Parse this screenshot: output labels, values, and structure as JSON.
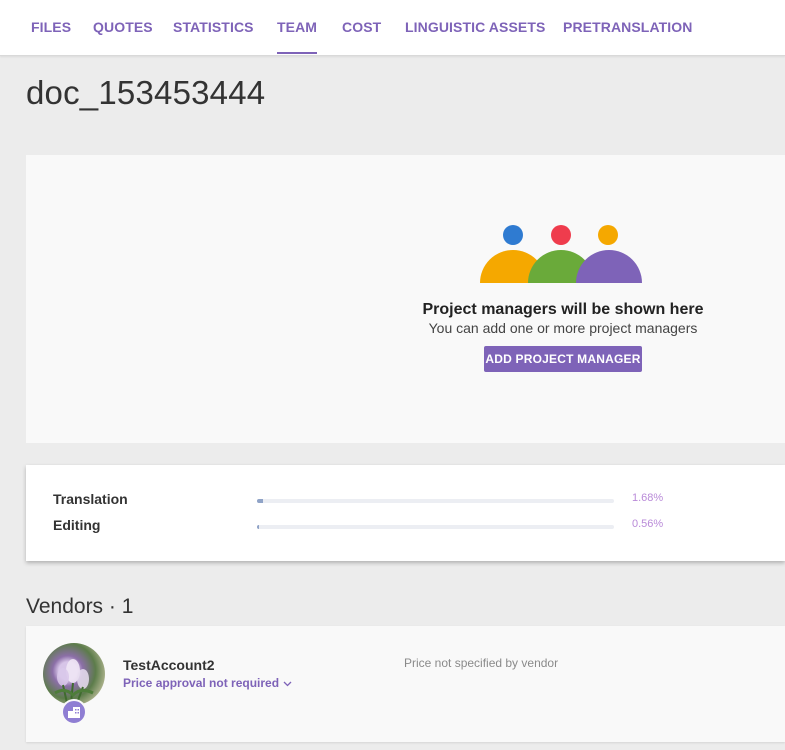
{
  "tabs": [
    {
      "label": "FILES",
      "active": false
    },
    {
      "label": "QUOTES",
      "active": false
    },
    {
      "label": "STATISTICS",
      "active": false
    },
    {
      "label": "TEAM",
      "active": true
    },
    {
      "label": "COST",
      "active": false
    },
    {
      "label": "LINGUISTIC ASSETS",
      "active": false
    },
    {
      "label": "PRETRANSLATION",
      "active": false
    }
  ],
  "document": {
    "title": "doc_153453444"
  },
  "project_managers": {
    "empty_title": "Project managers will be shown here",
    "empty_subtitle": "You can add one or more project managers",
    "add_button_label": "ADD PROJECT MANAGER",
    "illustration_colors": {
      "left_body": "#f5a800",
      "middle_body": "#6aaa3a",
      "right_body": "#7e63b8",
      "left_head": "#2f7bd1",
      "middle_head": "#ef3c4d",
      "right_head": "#f5a800"
    }
  },
  "progress": [
    {
      "label": "Translation",
      "percent_text": "1.68%",
      "percent": 1.68
    },
    {
      "label": "Editing",
      "percent_text": "0.56%",
      "percent": 0.56
    }
  ],
  "vendors": {
    "title": "Vendors · 1",
    "items": [
      {
        "name": "TestAccount2",
        "approval_label": "Price approval not required",
        "price_status": "Price not specified by vendor",
        "avatar_icon": "vendor-avatar-photo",
        "badge_icon": "company-building-icon"
      }
    ]
  },
  "colors": {
    "accent": "#7e63b8",
    "percent_text": "#b98ad8",
    "progress_fill": "#8fa3c7",
    "background": "#ececec"
  }
}
